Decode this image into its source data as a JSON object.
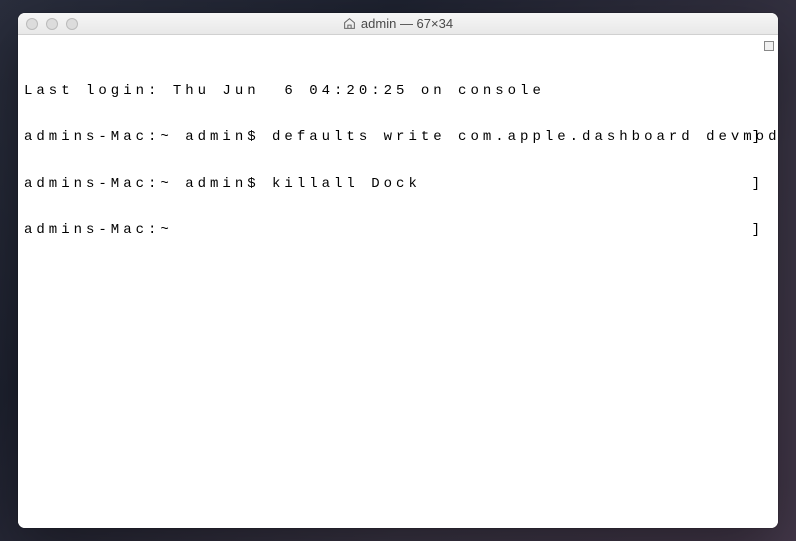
{
  "window": {
    "title": "admin — 67×34"
  },
  "terminal": {
    "lines": [
      {
        "text": "Last login: Thu Jun  6 04:20:25 on console",
        "bracket": false
      },
      {
        "text": "admins-Mac:~ admin$ defaults write com.apple.dashboard devmode YES",
        "bracket": true
      },
      {
        "text": "admins-Mac:~ admin$ killall Dock",
        "bracket": true
      },
      {
        "text": "admins-Mac:~ ",
        "bracket": true
      }
    ]
  }
}
